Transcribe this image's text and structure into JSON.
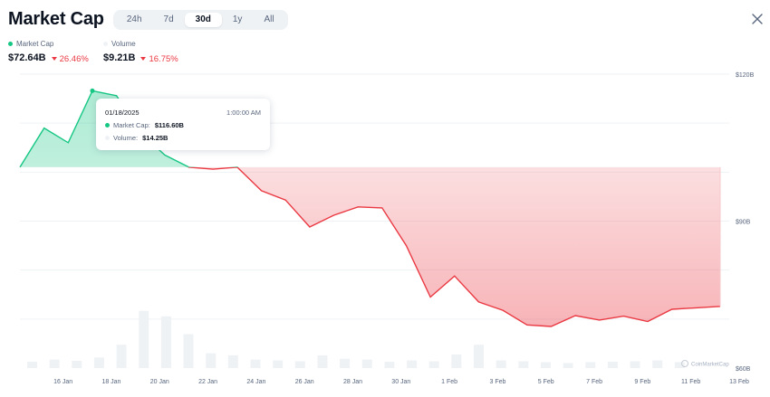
{
  "header": {
    "title": "Market Cap",
    "tabs": [
      {
        "label": "24h",
        "active": false
      },
      {
        "label": "7d",
        "active": false
      },
      {
        "label": "30d",
        "active": true
      },
      {
        "label": "1y",
        "active": false
      },
      {
        "label": "All",
        "active": false
      }
    ]
  },
  "legend": {
    "market_cap": {
      "label": "Market Cap",
      "value": "$72.64B",
      "change": "26.46%",
      "color": "#16c784"
    },
    "volume": {
      "label": "Volume",
      "value": "$9.21B",
      "change": "16.75%",
      "color": "#eff2f5"
    }
  },
  "tooltip": {
    "date": "01/18/2025",
    "time": "1:00:00 AM",
    "market_cap_label": "Market Cap:",
    "market_cap_value": "$116.60B",
    "volume_label": "Volume:",
    "volume_value": "$14.25B"
  },
  "watermark": "CoinMarketCap",
  "colors": {
    "up": "#16c784",
    "down": "#ea3943",
    "grid": "#eff2f5",
    "axis_text": "#58667e",
    "volume_bar": "#eff2f5"
  },
  "chart_data": {
    "type": "area",
    "ylim": [
      60,
      120
    ],
    "y_ticks": [
      "$120B",
      "$90B",
      "$60B"
    ],
    "y_tick_values": [
      120,
      90,
      60
    ],
    "x_tick_labels": [
      "16 Jan",
      "18 Jan",
      "20 Jan",
      "22 Jan",
      "24 Jan",
      "26 Jan",
      "28 Jan",
      "30 Jan",
      "1 Feb",
      "3 Feb",
      "5 Feb",
      "7 Feb",
      "9 Feb",
      "11 Feb",
      "13 Feb"
    ],
    "baseline": 101,
    "series": [
      {
        "name": "Market Cap",
        "values": [
          101.0,
          109.0,
          106.0,
          116.6,
          115.6,
          108.0,
          103.5,
          101.0,
          100.6,
          101.0,
          96.2,
          94.3,
          88.8,
          91.2,
          92.9,
          92.7,
          85.0,
          74.5,
          78.8,
          73.5,
          71.8,
          68.8,
          68.5,
          70.7,
          69.8,
          70.6,
          69.5,
          72.0,
          72.3,
          72.6
        ]
      },
      {
        "name": "Volume",
        "values": [
          1.5,
          2.0,
          1.7,
          2.5,
          5.5,
          13.5,
          12.2,
          8.0,
          3.5,
          3.0,
          2.0,
          1.8,
          1.6,
          3.0,
          2.2,
          2.0,
          1.5,
          1.8,
          1.6,
          3.2,
          5.5,
          1.8,
          1.6,
          1.4,
          1.2,
          1.4,
          1.5,
          1.6,
          1.8,
          1.4
        ]
      }
    ]
  }
}
